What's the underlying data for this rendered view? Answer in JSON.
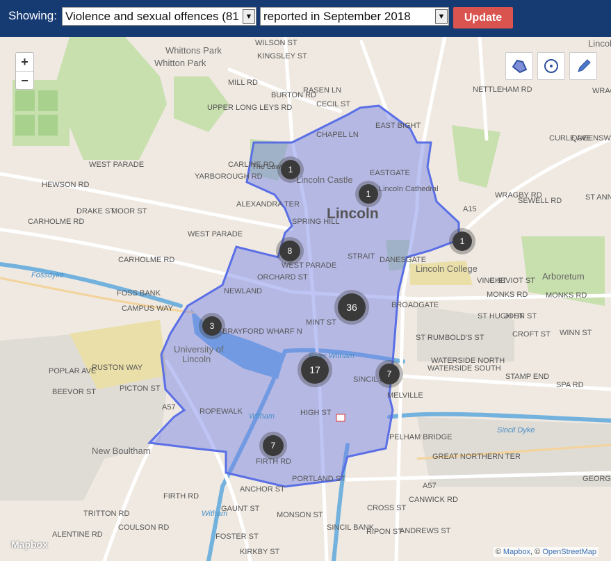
{
  "header": {
    "showing_label": "Showing:",
    "crime_select_value": "Violence and sexual offences (81",
    "period_select_value": "reported in September 2018",
    "update_label": "Update"
  },
  "colors": {
    "header_bg": "#163a72",
    "update_bg": "#d9534f",
    "polygon_fill": "#6f7de6",
    "polygon_stroke": "#5a6fe6",
    "cluster": "#3a3a3a"
  },
  "map": {
    "zoom_in": "+",
    "zoom_out": "−",
    "draw_tools": [
      "polygon-icon",
      "circle-icon",
      "pencil-icon"
    ],
    "logo": "Mapbox",
    "attribution_prefix": "©",
    "attribution_mapbox": "Mapbox",
    "attribution_sep": ", ©",
    "attribution_osm": "OpenStreetMap",
    "clusters": [
      {
        "label": "1"
      },
      {
        "label": "1"
      },
      {
        "label": "8"
      },
      {
        "label": "1"
      },
      {
        "label": "36"
      },
      {
        "label": "3"
      },
      {
        "label": "17"
      },
      {
        "label": "7"
      },
      {
        "label": "7"
      }
    ],
    "labels": {
      "whittons_park_1": "Whittons Park",
      "whittons_park_2": "Whitton Park",
      "wilson_st": "WILSON ST",
      "kingsley_st": "KINGSLEY ST",
      "mill_rd": "MILL RD",
      "burton_rd": "BURTON RD",
      "rasen_ln": "RASEN LN",
      "cecil_st": "CECIL ST",
      "upper_long_leys_rd": "UPPER LONG LEYS RD",
      "nettleham_rd": "NETTLEHAM RD",
      "lincoln_hospital": "Lincoln Hospit",
      "wragby": "WRAGB",
      "chapel_ln": "CHAPEL LN",
      "east_bight": "EAST BIGHT",
      "the_lawn": "The Lawn",
      "lincoln_castle": "Lincoln Castle",
      "eastgate": "EASTGATE",
      "lincoln_cathedral": "Lincoln Cathedral",
      "lincoln": "Lincoln",
      "west_parade_1": "WEST PARADE",
      "hewson_rd": "HEWSON RD",
      "carline_rd": "CARLINE RD",
      "yarborough_rd": "YARBOROUGH RD",
      "alexandra_ter": "ALEXANDRA TER",
      "drake_st": "DRAKE ST",
      "moor_st": "MOOR ST",
      "carholme_rd_1": "CARHOLME RD",
      "west_parade_2": "WEST PARADE",
      "spring_hill": "SPRING HILL",
      "wragby_rd": "WRAGBY RD",
      "curle_ave": "CURLE AVE",
      "queensway": "QUEENSWAY",
      "st_annes_rd": "ST ANNE'S RD",
      "sewell_rd": "SEWELL RD",
      "a15": "A15",
      "carholme_rd_2": "CARHOLME RD",
      "west_parade_3": "WEST PARADE",
      "strait": "STRAIT",
      "danesgate": "DANESGATE",
      "lincoln_college": "Lincoln College",
      "arboretum": "Arboretum",
      "fossdyke": "Fossdyke",
      "foss_bank": "FOSS BANK",
      "newland": "NEWLAND",
      "orchard_st": "ORCHARD ST",
      "campus_way": "CAMPUS WAY",
      "monks_rd_1": "MONKS RD",
      "monks_rd_2": "MONKS RD",
      "vine_st": "VINE ST",
      "cheviot_st": "CHEVIOT ST",
      "st_hugh_st": "ST HUGH ST",
      "john_st": "JOHN ST",
      "mint_st": "MINT ST",
      "broadgate": "BROADGATE",
      "brayford_wharf_n": "BRAYFORD WHARF N",
      "st_rumbolds_st": "ST RUMBOLD'S ST",
      "croft_st": "CROFT ST",
      "winn_st": "WINN ST",
      "university_1": "University of",
      "university_2": "Lincoln",
      "river_witham": "River Witham",
      "waterside_north": "WATERSIDE NORTH",
      "waterside_south": "WATERSIDE SOUTH",
      "stamp_end": "STAMP END",
      "spa_rd": "SPA RD",
      "poplar_ave": "POPLAR AVE",
      "ruston_way": "RUSTON WAY",
      "beevor_st": "BEEVOR ST",
      "picton_st": "PICTON ST",
      "sincil_st": "SINCIL ST",
      "melville": "MELVILLE",
      "a57_1": "A57",
      "ropewalk": "ROPEWALK",
      "high_st": "HIGH ST",
      "witham_1": "Witham",
      "sincil_dyke": "Sincil Dyke",
      "pelham_bridge": "PELHAM BRIDGE",
      "new_boultham": "New Boultham",
      "firth_rd_1": "FIRTH RD",
      "great_northern_ter": "GREAT NORTHERN TER",
      "george_st": "GEORGE S",
      "portland_st": "PORTLAND ST",
      "firth_rd_2": "FIRTH RD",
      "tritton_rd": "TRITTON RD",
      "valentine_rd": "ALENTINE RD",
      "anchor_st": "ANCHOR ST",
      "canwick_rd": "CANWICK RD",
      "a57_2": "A57",
      "witham_2": "Witham",
      "gaunt_st": "GAUNT ST",
      "monson_st": "MONSON ST",
      "sincil_bank": "SINCIL BANK",
      "cross_st": "CROSS ST",
      "ripon_st": "RIPON ST",
      "foster_st": "FOSTER ST",
      "coulson_rd": "COULSON RD",
      "andrews_st": "ANDREWS ST",
      "kirkby_st": "KIRKBY ST"
    }
  }
}
